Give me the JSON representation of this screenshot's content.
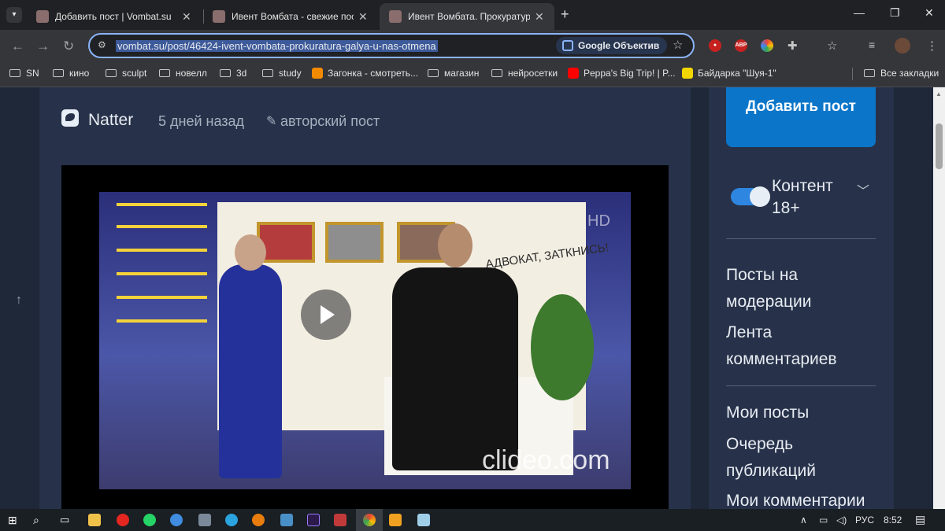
{
  "browser": {
    "tabs": [
      {
        "title": "Добавить пост | Vombat.su"
      },
      {
        "title": "Ивент Вомбата - свежие посты"
      },
      {
        "title": "Ивент Вомбата. Прокуратура..."
      }
    ],
    "new_tab_symbol": "+",
    "address": "vombat.su/post/46424-ivent-vombata-prokuratura-galya-u-nas-otmena",
    "lens_label": "Google Объектив",
    "ext_abp": "ABP",
    "bookmarks": [
      {
        "label": "SN",
        "icon": "folder-icon"
      },
      {
        "label": "кино",
        "icon": "folder-icon"
      },
      {
        "label": "sculpt",
        "icon": "folder-icon"
      },
      {
        "label": "новелл",
        "icon": "folder-icon"
      },
      {
        "label": "3d",
        "icon": "folder-icon"
      },
      {
        "label": "study",
        "icon": "folder-icon"
      },
      {
        "label": "Загонка - смотреть...",
        "icon": "zagonka-icon"
      },
      {
        "label": "магазин",
        "icon": "folder-icon"
      },
      {
        "label": "нейросетки",
        "icon": "folder-icon"
      },
      {
        "label": "Peppa's Big Trip! | P...",
        "icon": "youtube-icon"
      },
      {
        "label": "Байдарка \"Шуя-1\"",
        "icon": "site-icon"
      }
    ],
    "all_bookmarks": "Все закладки",
    "colors": {
      "tabbar": "#202124",
      "toolbar": "#35363a",
      "url_highlight": "#3d5a9a"
    }
  },
  "post": {
    "author": "Natter",
    "time_ago": "5 дней назад",
    "tag": "авторский пост",
    "video_watermark": "clideo.com",
    "video_hd": "HD",
    "video_sign": "АДВОКАТ, ЗАТКНИСЬ!"
  },
  "sidebar": {
    "add_post": "Добавить пост",
    "content_18_toggle": {
      "label": "Контент 18+",
      "on": true
    },
    "links_group1": [
      "Посты на модерации",
      "Лента комментариев"
    ],
    "links_group2": [
      "Мои посты",
      "Очередь публикаций",
      "Мои комментарии"
    ]
  },
  "taskbar": {
    "language": "РУС",
    "time": "8:52"
  },
  "colors": {
    "page_bg": "#1e2838",
    "card_bg": "#27324a",
    "accent_button": "#0b76c9",
    "toggle_on": "#2f86e0"
  }
}
